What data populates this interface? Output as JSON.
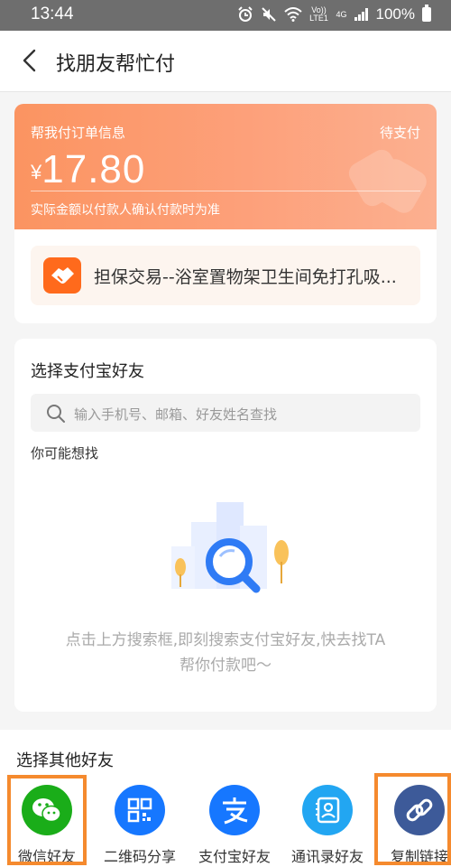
{
  "status_bar": {
    "time": "13:44",
    "network_volte": "Vo)) LTE1",
    "network_4g": "4G",
    "battery": "100%"
  },
  "nav": {
    "title": "找朋友帮忙付"
  },
  "order": {
    "label": "帮我付订单信息",
    "status": "待支付",
    "currency": "¥",
    "amount": "17.80",
    "note": "实际金额以付款人确认付款时为准",
    "product": "担保交易--浴室置物架卫生间免打孔吸..."
  },
  "friends": {
    "title": "选择支付宝好友",
    "search_placeholder": "输入手机号、邮箱、好友姓名查找",
    "maybe_title": "你可能想找",
    "hint_line1": "点击上方搜索框,即刻搜索支付宝好友,快去找TA",
    "hint_line2": "帮你付款吧～"
  },
  "others": {
    "title": "选择其他好友",
    "items": [
      {
        "label": "微信好友",
        "icon": "wechat-icon",
        "color": "#1aad19"
      },
      {
        "label": "二维码分享",
        "icon": "qrcode-icon",
        "color": "#1677ff"
      },
      {
        "label": "支付宝好友",
        "icon": "alipay-icon",
        "color": "#1677ff"
      },
      {
        "label": "通讯录好友",
        "icon": "contacts-icon",
        "color": "#22a6f2"
      },
      {
        "label": "复制链接",
        "icon": "link-icon",
        "color": "#3d5a99"
      }
    ]
  },
  "colors": {
    "accent": "#fb9461",
    "highlight": "#f58a2e"
  }
}
